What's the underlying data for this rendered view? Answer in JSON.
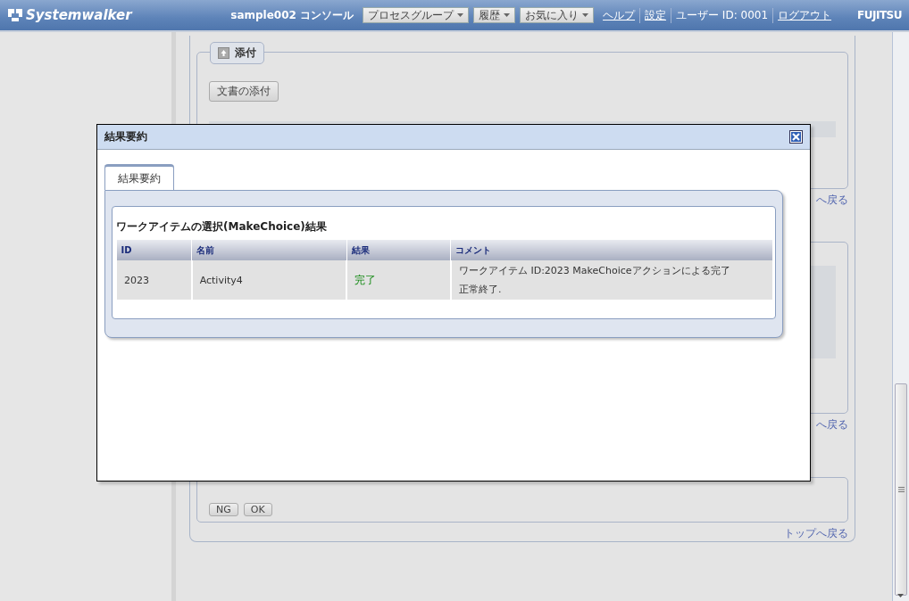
{
  "header": {
    "logo": "Systemwalker",
    "console_title": "sample002 コンソール",
    "menus": [
      {
        "label": "プロセスグループ"
      },
      {
        "label": "履歴"
      },
      {
        "label": "お気に入り"
      }
    ],
    "links": [
      {
        "label": "ヘルプ",
        "kind": "link"
      },
      {
        "label": "設定",
        "kind": "link"
      },
      {
        "label": "ユーザー ID: 0001",
        "kind": "text"
      },
      {
        "label": "ログアウト",
        "kind": "link"
      }
    ],
    "brand": "FUJITSU"
  },
  "page": {
    "attachment": {
      "legend": "添付",
      "button": "文書の添付"
    },
    "back_links": [
      "へ戻る",
      "へ戻る",
      "トップへ戻る"
    ],
    "decision_buttons": [
      "NG",
      "OK"
    ]
  },
  "dialog": {
    "title": "結果要約",
    "tabs": [
      {
        "label": "結果要約",
        "selected": true
      }
    ],
    "heading": "ワークアイテムの選択(MakeChoice)結果",
    "table": {
      "columns": [
        "ID",
        "名前",
        "結果",
        "コメント"
      ],
      "rows": [
        {
          "id": "2023",
          "name": "Activity4",
          "result": "完了",
          "comment": [
            "ワークアイテム ID:2023 MakeChoiceアクションによる完了",
            "正常終了."
          ]
        }
      ]
    }
  }
}
